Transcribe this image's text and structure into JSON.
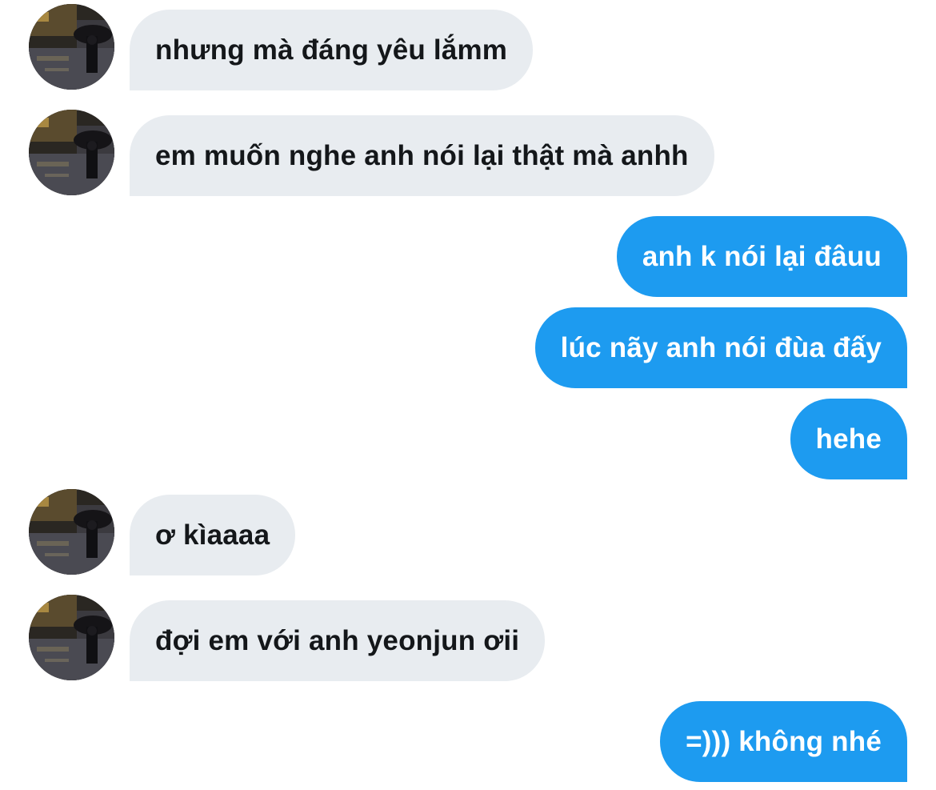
{
  "conversation": {
    "messages": [
      {
        "direction": "incoming",
        "text": "nhưng mà đáng yêu lắmm",
        "avatar": "user-avatar-photo"
      },
      {
        "direction": "incoming",
        "text": "em muốn nghe anh nói lại thật mà anhh",
        "avatar": "user-avatar-photo"
      },
      {
        "direction": "outgoing",
        "text": "anh k nói lại đâuu"
      },
      {
        "direction": "outgoing",
        "text": "lúc nãy anh nói đùa đấy"
      },
      {
        "direction": "outgoing",
        "text": "hehe"
      },
      {
        "direction": "incoming",
        "text": "ơ kìaaaa",
        "avatar": "user-avatar-photo"
      },
      {
        "direction": "incoming",
        "text": "đợi em với anh yeonjun ơii",
        "avatar": "user-avatar-photo"
      },
      {
        "direction": "outgoing",
        "text": "=))) không nhé"
      }
    ]
  },
  "colors": {
    "incoming_bubble": "#e8ecf0",
    "incoming_text": "#14171a",
    "outgoing_bubble": "#1d9bf0",
    "outgoing_text": "#ffffff",
    "background": "#ffffff"
  }
}
